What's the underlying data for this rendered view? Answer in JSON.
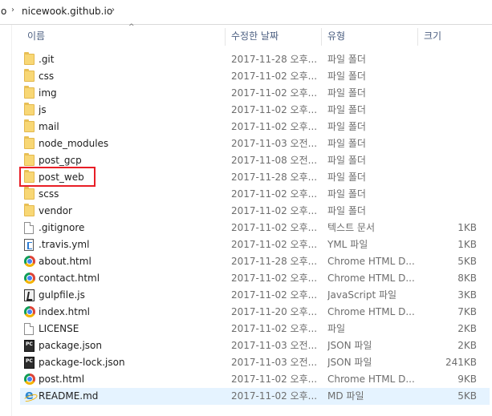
{
  "breadcrumb": {
    "prev_fragment": "o",
    "current": "nicewook.github.io"
  },
  "header": {
    "name": "이름",
    "date": "수정한 날짜",
    "type": "유형",
    "size": "크기"
  },
  "files": [
    {
      "name": ".git",
      "date": "2017-11-28 오후...",
      "type": "파일 폴더",
      "size": "",
      "icon": "folder-icon"
    },
    {
      "name": "css",
      "date": "2017-11-02 오후...",
      "type": "파일 폴더",
      "size": "",
      "icon": "folder-icon"
    },
    {
      "name": "img",
      "date": "2017-11-02 오후...",
      "type": "파일 폴더",
      "size": "",
      "icon": "folder-icon"
    },
    {
      "name": "js",
      "date": "2017-11-02 오후...",
      "type": "파일 폴더",
      "size": "",
      "icon": "folder-icon"
    },
    {
      "name": "mail",
      "date": "2017-11-02 오후...",
      "type": "파일 폴더",
      "size": "",
      "icon": "folder-icon"
    },
    {
      "name": "node_modules",
      "date": "2017-11-03 오전...",
      "type": "파일 폴더",
      "size": "",
      "icon": "folder-icon"
    },
    {
      "name": "post_gcp",
      "date": "2017-11-08 오전...",
      "type": "파일 폴더",
      "size": "",
      "icon": "folder-icon"
    },
    {
      "name": "post_web",
      "date": "2017-11-28 오후...",
      "type": "파일 폴더",
      "size": "",
      "icon": "folder-icon"
    },
    {
      "name": "scss",
      "date": "2017-11-02 오후...",
      "type": "파일 폴더",
      "size": "",
      "icon": "folder-icon"
    },
    {
      "name": "vendor",
      "date": "2017-11-02 오후...",
      "type": "파일 폴더",
      "size": "",
      "icon": "folder-icon"
    },
    {
      "name": ".gitignore",
      "date": "2017-11-02 오후...",
      "type": "텍스트 문서",
      "size": "1KB",
      "icon": "text-file-icon"
    },
    {
      "name": ".travis.yml",
      "date": "2017-11-02 오후...",
      "type": "YML 파일",
      "size": "1KB",
      "icon": "yml-file-icon"
    },
    {
      "name": "about.html",
      "date": "2017-11-28 오후...",
      "type": "Chrome HTML D...",
      "size": "5KB",
      "icon": "chrome-html-icon"
    },
    {
      "name": "contact.html",
      "date": "2017-11-02 오후...",
      "type": "Chrome HTML D...",
      "size": "8KB",
      "icon": "chrome-html-icon"
    },
    {
      "name": "gulpfile.js",
      "date": "2017-11-02 오후...",
      "type": "JavaScript 파일",
      "size": "3KB",
      "icon": "javascript-file-icon"
    },
    {
      "name": "index.html",
      "date": "2017-11-20 오후...",
      "type": "Chrome HTML D...",
      "size": "7KB",
      "icon": "chrome-html-icon"
    },
    {
      "name": "LICENSE",
      "date": "2017-11-02 오후...",
      "type": "파일",
      "size": "2KB",
      "icon": "blank-file-icon"
    },
    {
      "name": "package.json",
      "date": "2017-11-03 오전...",
      "type": "JSON 파일",
      "size": "2KB",
      "icon": "json-file-icon"
    },
    {
      "name": "package-lock.json",
      "date": "2017-11-03 오전...",
      "type": "JSON 파일",
      "size": "241KB",
      "icon": "json-file-icon"
    },
    {
      "name": "post.html",
      "date": "2017-11-02 오후...",
      "type": "Chrome HTML D...",
      "size": "9KB",
      "icon": "chrome-html-icon"
    },
    {
      "name": "README.md",
      "date": "2017-11-02 오후...",
      "type": "MD 파일",
      "size": "5KB",
      "icon": "ie-document-icon",
      "selected": true
    }
  ],
  "highlighted_item": "post_web",
  "colors": {
    "highlight_border": "#e81e26",
    "selected_row": "#e5f3ff",
    "header_text": "#4d6082",
    "folder": "#f8d775"
  }
}
